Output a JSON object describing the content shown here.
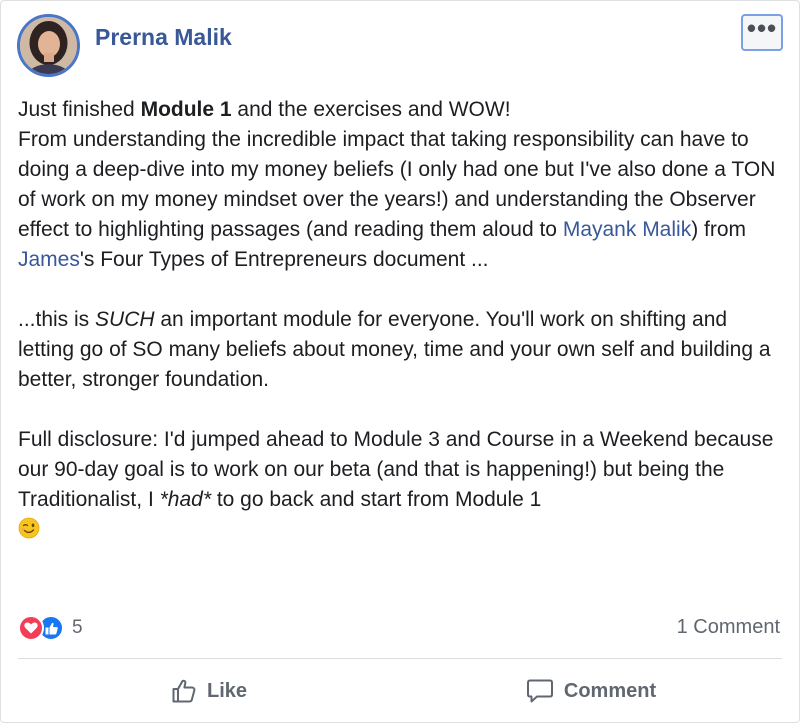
{
  "post": {
    "author": "Prerna Malik",
    "more_options": "•••",
    "paragraph1": {
      "line1_pre": "Just finished ",
      "line1_bold": "Module 1",
      "line1_post": " and the exercises and WOW!",
      "text_a": "From understanding the incredible impact that taking responsibility can have to doing a deep-dive into my money beliefs (I only had one but I've also done a TON of work on my money mindset over the years!) and understanding the Observer effect to highlighting passages (and reading them aloud to ",
      "mention1": "Mayank Malik",
      "text_b": ") from ",
      "mention2": "James",
      "text_c": "'s Four Types of Entrepreneurs document ..."
    },
    "paragraph2": {
      "pre": "...this is ",
      "emph": "SUCH",
      "post": " an important module for everyone. You'll work on shifting and letting go of SO many beliefs about money, time and your own self and building a better, stronger foundation."
    },
    "paragraph3": {
      "pre": "Full disclosure: I'd jumped ahead to Module 3 and Course in a Weekend because our 90-day goal is to work on our beta (and that is happening!) but being the Traditionalist, I ",
      "emph": "*had*",
      "post": " to go back and start from Module 1",
      "emoji": "wink-emoji"
    }
  },
  "reactions": {
    "icons": [
      "love-reaction-icon",
      "like-reaction-icon"
    ],
    "count": "5"
  },
  "comments": {
    "count_label": "1 Comment"
  },
  "actions": {
    "like_label": "Like",
    "comment_label": "Comment"
  },
  "colors": {
    "link": "#385898",
    "love": "#f33e58",
    "like": "#1877f2",
    "muted": "#606770"
  }
}
